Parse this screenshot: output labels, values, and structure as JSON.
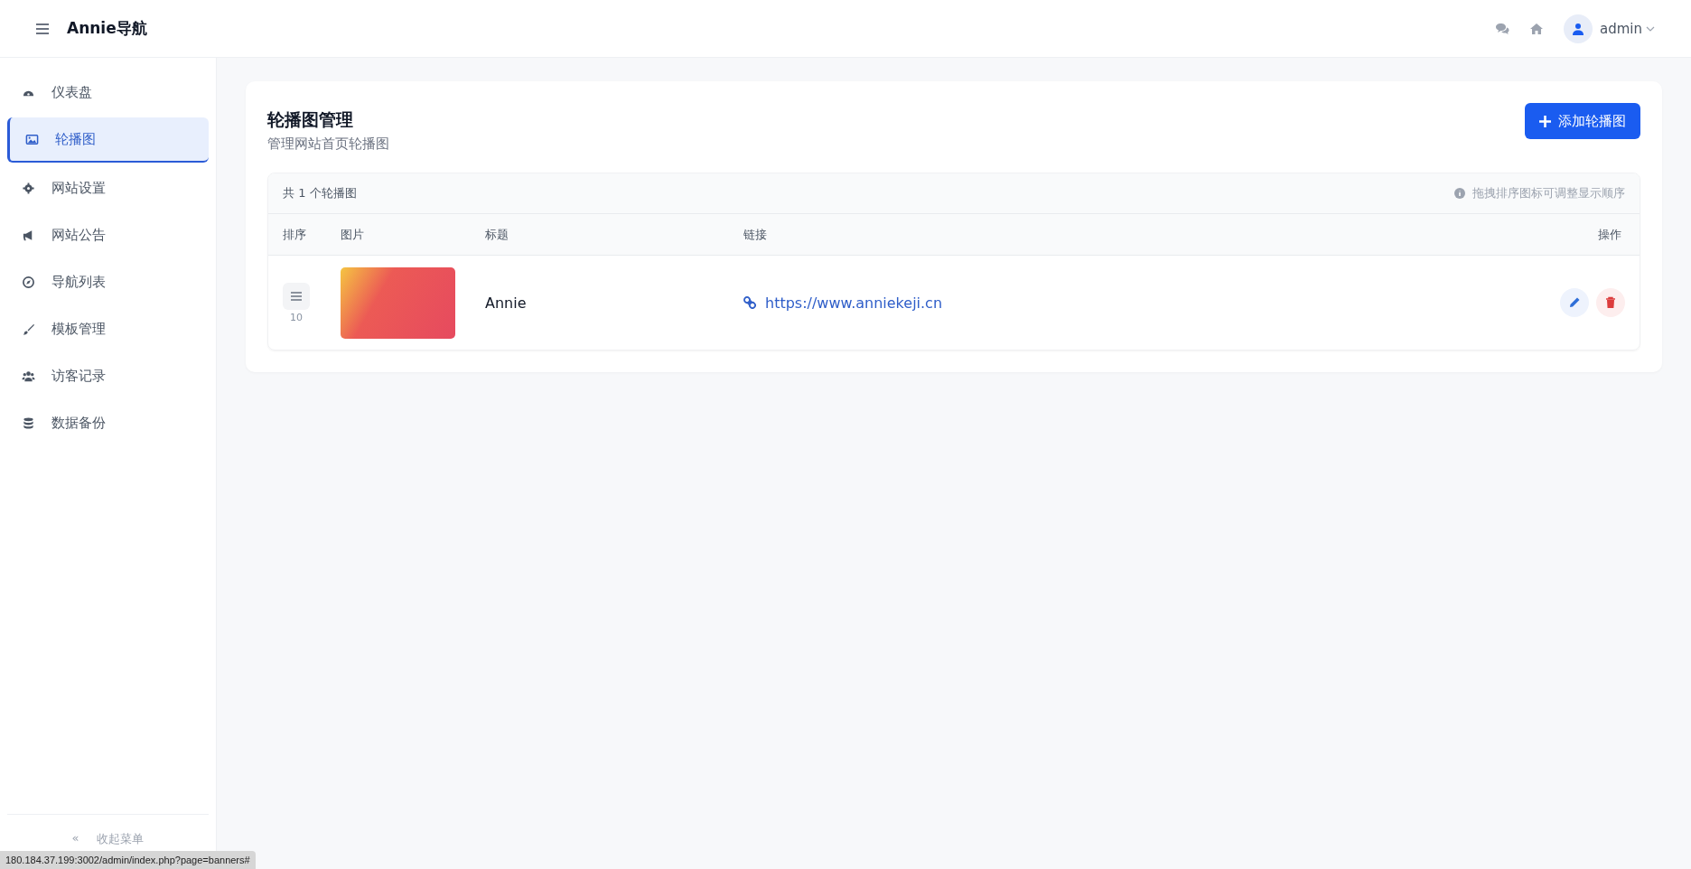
{
  "header": {
    "brand": "Annie导航",
    "user": {
      "name": "admin"
    }
  },
  "sidebar": {
    "items": [
      {
        "label": "仪表盘",
        "selected": false
      },
      {
        "label": "轮播图",
        "selected": true
      },
      {
        "label": "网站设置",
        "selected": false
      },
      {
        "label": "网站公告",
        "selected": false
      },
      {
        "label": "导航列表",
        "selected": false
      },
      {
        "label": "模板管理",
        "selected": false
      },
      {
        "label": "访客记录",
        "selected": false
      },
      {
        "label": "数据备份",
        "selected": false
      }
    ],
    "collapse": {
      "glyph": "«",
      "label": "收起菜单"
    }
  },
  "page": {
    "title": "轮播图管理",
    "subtitle": "管理网站首页轮播图",
    "add_button": "添加轮播图"
  },
  "table": {
    "count": "共 1 个轮播图",
    "hint": "拖拽排序图标可调整显示顺序",
    "columns": [
      "排序",
      "图片",
      "标题",
      "链接",
      "操作"
    ],
    "rows": [
      {
        "sort": "10",
        "title": "Annie",
        "link": "https://www.anniekeji.cn"
      }
    ]
  },
  "status_url": "180.184.37.199:3002/admin/index.php?page=banners#"
}
